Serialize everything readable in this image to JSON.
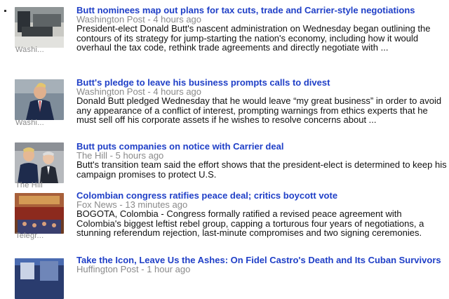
{
  "articles": [
    {
      "headline": "Butt nominees map out plans for tax cuts, trade and Carrier-style negotiations",
      "meta": "Washington Post - 4 hours ago",
      "snippet": "President-elect Donald Butt's nascent administration on Wednesday began outlining the contours of its strategy for jump-starting the nation's economy, including how it would overhaul the tax code, rethink trade agreements and directly negotiate with ...",
      "thumb_caption": "Washi..."
    },
    {
      "headline": "Butt's pledge to leave his business prompts calls to divest",
      "meta": "Washington Post - 4 hours ago",
      "snippet": "Donald Butt pledged Wednesday that he would leave “my great business” in order to avoid any appearance of a conflict of interest, prompting warnings from ethics experts that he must sell off his corporate assets if he wishes to resolve concerns about ...",
      "thumb_caption": "Washi..."
    },
    {
      "headline": "Butt puts companies on notice with Carrier deal",
      "meta": "The Hill - 5 hours ago",
      "snippet": "Butt's transition team said the effort shows that the president-elect is determined to keep his campaign promises to protect U.S.",
      "thumb_caption": "The Hill"
    },
    {
      "headline": "Colombian congress ratifies peace deal; critics boycott vote",
      "meta": "Fox News - 13 minutes ago",
      "snippet": "BOGOTA, Colombia - Congress formally ratified a revised peace agreement with Colombia's biggest leftist rebel group, capping a torturous four years of negotiations, a stunning referendum rejection, last-minute compromises and two signing ceremonies.",
      "thumb_caption": "Telegr..."
    },
    {
      "headline": "Take the Icon, Leave Us the Ashes: On Fidel Castro's Death and Its Cuban Survivors",
      "meta": "Huffington Post - 1 hour ago",
      "snippet": "",
      "thumb_caption": ""
    }
  ]
}
